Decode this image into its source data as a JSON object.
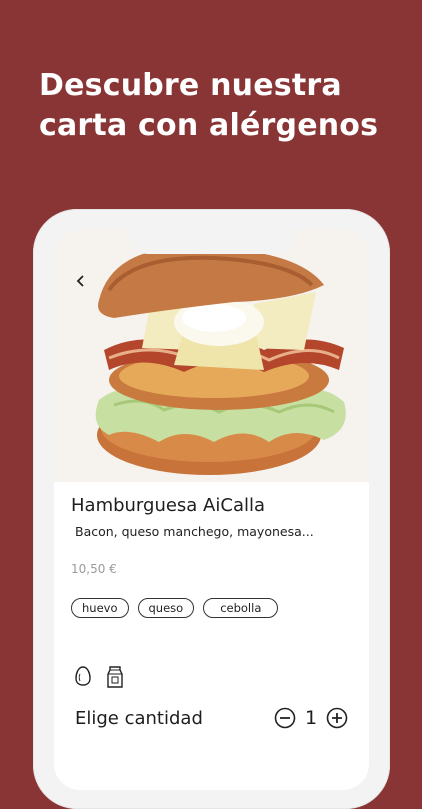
{
  "headline": {
    "line1": "Descubre nuestra",
    "line2": "carta con alérgenos"
  },
  "colors": {
    "background": "#8a3535",
    "headline_text": "#ffffff"
  },
  "screen": {
    "back_icon": "chevron-left-icon",
    "dish": {
      "name": "Hamburguesa AiCalla",
      "description": "Bacon, queso manchego, mayonesa...",
      "price": "10,50 €",
      "tags": [
        "huevo",
        "queso",
        "cebolla"
      ]
    },
    "allergen_icons": [
      "egg-icon",
      "milk-carton-icon"
    ],
    "quantity": {
      "label": "Elige cantidad",
      "value": "1",
      "decrease_icon": "minus-circle-icon",
      "increase_icon": "plus-circle-icon"
    }
  }
}
